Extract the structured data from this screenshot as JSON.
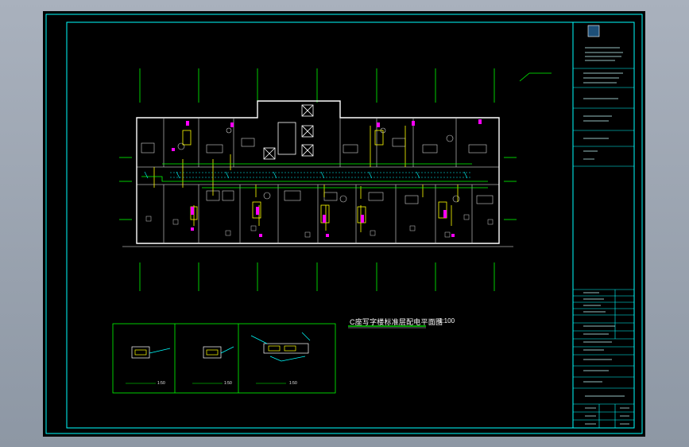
{
  "drawing": {
    "main_title": "C座写字楼标准层配电平面图",
    "main_scale": "1:100",
    "detail_scale_1": "1:50",
    "detail_scale_2": "1:50",
    "detail_scale_3": "1:50"
  },
  "colors": {
    "background": "#000000",
    "frame": "#00ffff",
    "wall": "#ffffff",
    "axis": "#00ff00",
    "circuit": "#ffff00",
    "device": "#ff00ff",
    "annotation": "#00ffff"
  }
}
